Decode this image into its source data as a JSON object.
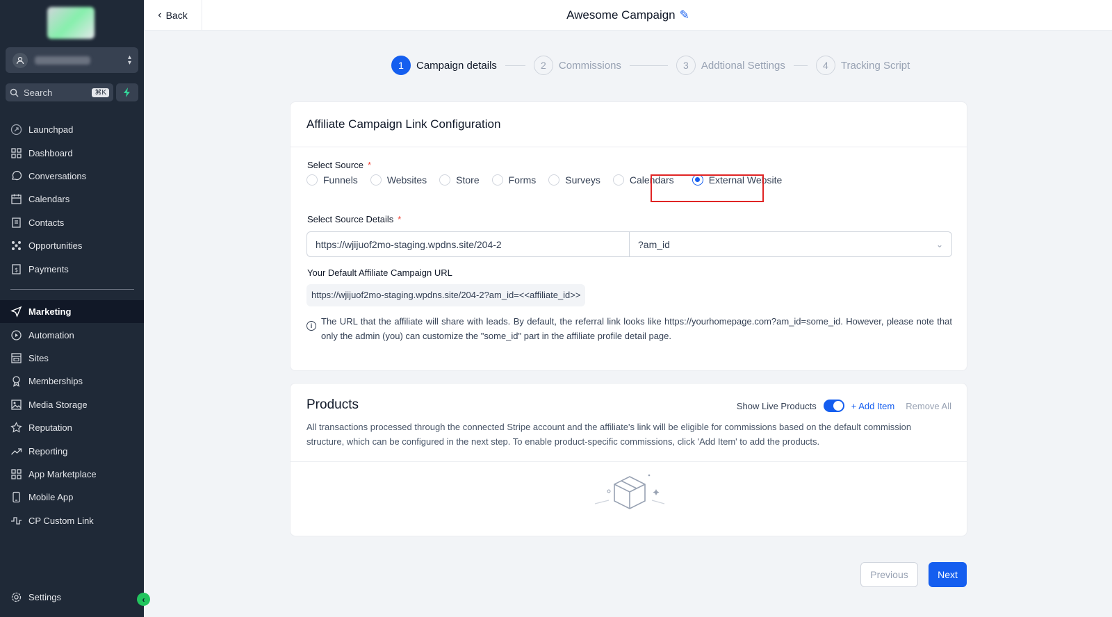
{
  "topbar": {
    "back_label": "Back",
    "campaign_title": "Awesome Campaign"
  },
  "sidebar": {
    "search_placeholder": "Search",
    "search_shortcut": "⌘K",
    "items": [
      {
        "label": "Launchpad",
        "icon": "rocket-icon"
      },
      {
        "label": "Dashboard",
        "icon": "grid-icon"
      },
      {
        "label": "Conversations",
        "icon": "chat-icon"
      },
      {
        "label": "Calendars",
        "icon": "calendar-icon"
      },
      {
        "label": "Contacts",
        "icon": "contacts-icon"
      },
      {
        "label": "Opportunities",
        "icon": "opportunities-icon"
      },
      {
        "label": "Payments",
        "icon": "payments-icon"
      }
    ],
    "items2": [
      {
        "label": "Marketing",
        "icon": "send-icon"
      },
      {
        "label": "Automation",
        "icon": "automation-icon"
      },
      {
        "label": "Sites",
        "icon": "sites-icon"
      },
      {
        "label": "Memberships",
        "icon": "award-icon"
      },
      {
        "label": "Media Storage",
        "icon": "image-icon"
      },
      {
        "label": "Reputation",
        "icon": "star-icon"
      },
      {
        "label": "Reporting",
        "icon": "trend-icon"
      },
      {
        "label": "App Marketplace",
        "icon": "apps-icon"
      },
      {
        "label": "Mobile App",
        "icon": "phone-icon"
      },
      {
        "label": "CP Custom Link",
        "icon": "link-icon"
      }
    ],
    "settings_label": "Settings",
    "active": "Marketing"
  },
  "stepper": {
    "steps": [
      {
        "num": "1",
        "label": "Campaign details"
      },
      {
        "num": "2",
        "label": "Commissions"
      },
      {
        "num": "3",
        "label": "Addtional Settings"
      },
      {
        "num": "4",
        "label": "Tracking Script"
      }
    ],
    "current": "1"
  },
  "config": {
    "heading": "Affiliate Campaign Link Configuration",
    "source_label": "Select Source",
    "required_mark": "*",
    "sources": [
      "Funnels",
      "Websites",
      "Store",
      "Forms",
      "Surveys",
      "Calendars",
      "External Website"
    ],
    "selected_source": "External Website",
    "details_label": "Select Source Details",
    "url_value": "https://wjijuof2mo-staging.wpdns.site/204-2",
    "param_value": "?am_id",
    "default_url_label": "Your Default Affiliate Campaign URL",
    "default_url": "https://wjijuof2mo-staging.wpdns.site/204-2?am_id=<<affiliate_id>>",
    "note": "The URL that the affiliate will share with leads. By default, the referral link looks like https://yourhomepage.com?am_id=some_id. However, please note that only the admin (you) can customize the \"some_id\" part in the affiliate profile detail page."
  },
  "products": {
    "title": "Products",
    "show_live_label": "Show Live Products",
    "show_live_on": true,
    "add_item_label": "+ Add Item",
    "remove_all_label": "Remove All",
    "description": "All transactions processed through the connected Stripe account and the affiliate's link will be eligible for commissions based on the default commission structure, which can be configured in the next step. To enable product-specific commissions, click 'Add Item' to add the products."
  },
  "footer": {
    "previous_label": "Previous",
    "next_label": "Next"
  },
  "colors": {
    "accent": "#155eef",
    "sidebar_bg": "#1f2937",
    "highlight": "#e02424",
    "bolt": "#34d399"
  }
}
